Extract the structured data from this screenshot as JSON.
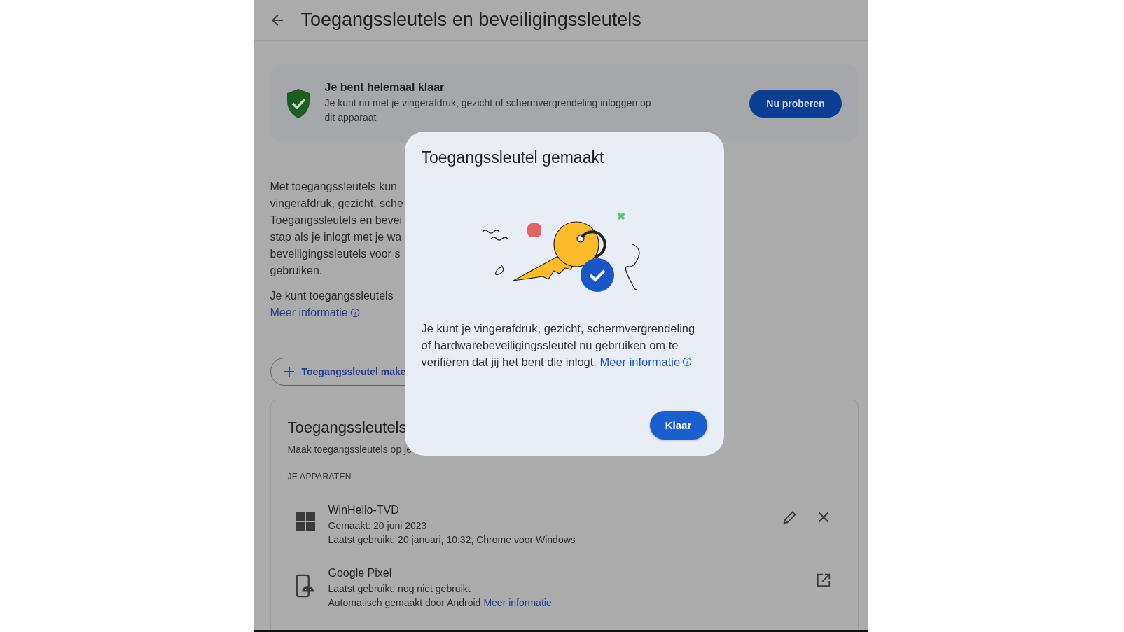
{
  "header": {
    "title": "Toegangssleutels en beveiligingssleutels"
  },
  "banner": {
    "title": "Je bent helemaal klaar",
    "text": "Je kunt nu met je vingerafdruk, gezicht of schermvergrendeling inloggen op dit apparaat",
    "button": "Nu proberen"
  },
  "intro": {
    "lines": [
      "Met toegangssleutels kun",
      "vingerafdruk, gezicht, sche",
      "Toegangssleutels en bevei",
      "stap als je inlogt met je wa",
      "beveiligingssleutels voor s",
      "gebruiken."
    ],
    "second": "Je kunt toegangssleutels",
    "link": "Meer informatie"
  },
  "create_button": {
    "label": "Toegangssleutel make"
  },
  "passkeys": {
    "title": "Toegangssleutels",
    "subtitle": "Maak toegangssleutels op je",
    "section": "JE APPARATEN",
    "devices": [
      {
        "kind": "windows",
        "name": "WinHello-TVD",
        "lines": [
          {
            "text": "Gemaakt: 20 juni 2023"
          },
          {
            "text": "Laatst gebruikt: 20 januari, 10:32, Chrome voor Windows"
          }
        ],
        "actions": [
          {
            "kind": "edit"
          },
          {
            "kind": "remove"
          }
        ]
      },
      {
        "kind": "android",
        "name": "Google Pixel",
        "lines": [
          {
            "text": "Laatst gebruikt: nog niet gebruikt"
          },
          {
            "text": "Automatisch gemaakt door Android",
            "link": "Meer informatie"
          }
        ],
        "actions": [
          {
            "kind": "open"
          }
        ]
      }
    ]
  },
  "dialog": {
    "title": "Toegangssleutel gemaakt",
    "text": "Je kunt je vingerafdruk, gezicht, schermvergrendeling of hardwarebeveiligingssleutel nu gebruiken om te verifiëren dat jij het bent die inlogt.",
    "link": "Meer informatie",
    "button": "Klaar"
  }
}
